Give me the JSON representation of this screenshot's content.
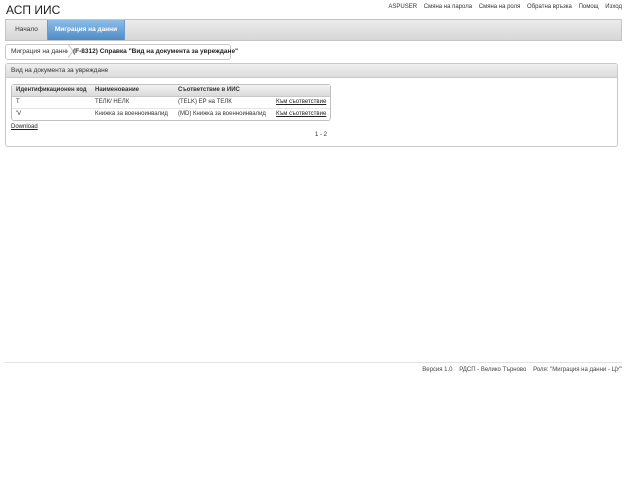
{
  "app": {
    "title": "АСП ИИС"
  },
  "top_links": [
    "ASPUSER",
    "Смяна на парола",
    "Смяна на роля",
    "Обратна връзка",
    "Помощ",
    "Изход"
  ],
  "nav": {
    "tabs": [
      {
        "label": "Начало"
      },
      {
        "label": "Миграция на данни",
        "active": true
      }
    ]
  },
  "breadcrumb": {
    "items": [
      "Миграция на данни",
      "(F-8312) Справка \"Вид на документа за увреждане\""
    ]
  },
  "panel": {
    "title": "Вид на документа за увреждане",
    "table": {
      "headers": [
        "Идентификационен код",
        "Наименование",
        "Съответствие в ИИС",
        ""
      ],
      "rows": [
        [
          "Т",
          "ТЕЛК/ НЕЛК",
          "(TELK) ЕР на ТЕЛК",
          "Към съответствие"
        ],
        [
          "'V",
          "Книжка за военноинвалид",
          "(MD) Книжка за военноинвалид",
          "Към съответствие"
        ]
      ]
    },
    "download_label": "Download",
    "pager": "1 - 2"
  },
  "footer": {
    "items": [
      "Версия 1.0",
      "РДСП - Велико Търново",
      "Роля: \"Миграция на данни - ЦУ\""
    ]
  },
  "colors": {
    "active_tab_top": "#8cbde8",
    "active_tab_bottom": "#4f8bc7",
    "border": "#c8c8c8"
  }
}
